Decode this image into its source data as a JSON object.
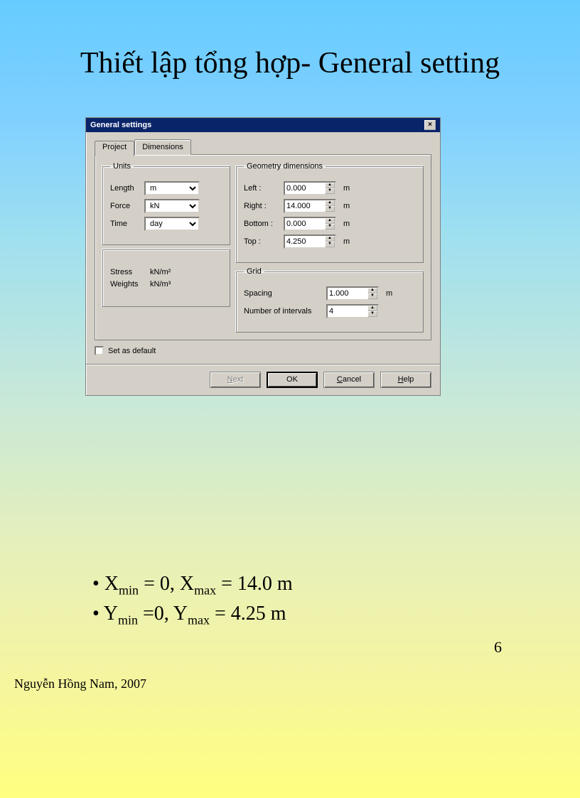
{
  "slide": {
    "title": "Thiết lập tổng hợp- General setting",
    "page_number": "6",
    "author": "Nguyễn Hồng Nam, 2007",
    "bullets": {
      "line1_a": "X",
      "line1_sub_a": "min",
      "line1_b": " = 0, X",
      "line1_sub_b": "max",
      "line1_c": " = 14.0 m",
      "line2_a": "Y",
      "line2_sub_a": "min",
      "line2_b": " =0, Y",
      "line2_sub_b": "max",
      "line2_c": " = 4.25 m"
    }
  },
  "dialog": {
    "title": "General settings",
    "close": "×",
    "tabs": {
      "project": "Project",
      "dimensions": "Dimensions"
    },
    "units": {
      "legend": "Units",
      "length_label": "Length",
      "length_value": "m",
      "force_label": "Force",
      "force_value": "kN",
      "time_label": "Time",
      "time_value": "day"
    },
    "derived": {
      "stress_label": "Stress",
      "stress_value": "kN/m²",
      "weights_label": "Weights",
      "weights_value": "kN/m³"
    },
    "geometry": {
      "legend": "Geometry dimensions",
      "left_label": "Left :",
      "left_value": "0.000",
      "left_unit": "m",
      "right_label": "Right :",
      "right_value": "14.000",
      "right_unit": "m",
      "bottom_label": "Bottom :",
      "bottom_value": "0.000",
      "bottom_unit": "m",
      "top_label": "Top :",
      "top_value": "4.250",
      "top_unit": "m"
    },
    "grid": {
      "legend": "Grid",
      "spacing_label": "Spacing",
      "spacing_value": "1.000",
      "spacing_unit": "m",
      "intervals_label": "Number of intervals",
      "intervals_value": "4"
    },
    "set_default": "Set as default",
    "buttons": {
      "next": "Next",
      "ok": "OK",
      "cancel": "Cancel",
      "help": "Help"
    }
  }
}
